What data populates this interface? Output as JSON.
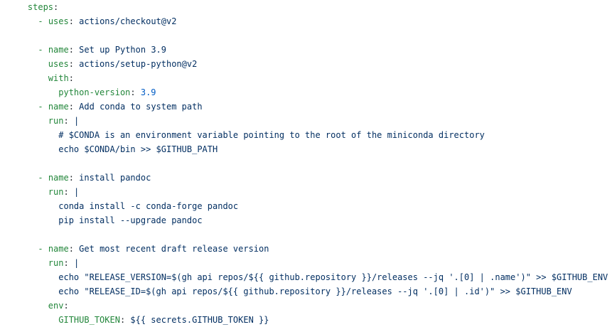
{
  "editor": {
    "lines": [
      {
        "indent": 4,
        "dash": false,
        "key": "steps",
        "sep": ":",
        "value": "",
        "kind": "val"
      },
      {
        "indent": 6,
        "dash": true,
        "key": "uses",
        "sep": ": ",
        "value": "actions/checkout@v2",
        "kind": "val"
      },
      {
        "indent": 0,
        "dash": false,
        "key": "",
        "sep": "",
        "value": "",
        "kind": "val"
      },
      {
        "indent": 6,
        "dash": true,
        "key": "name",
        "sep": ": ",
        "value": "Set up Python 3.9",
        "kind": "val"
      },
      {
        "indent": 8,
        "dash": false,
        "key": "uses",
        "sep": ": ",
        "value": "actions/setup-python@v2",
        "kind": "val"
      },
      {
        "indent": 8,
        "dash": false,
        "key": "with",
        "sep": ":",
        "value": "",
        "kind": "val"
      },
      {
        "indent": 10,
        "dash": false,
        "key": "python-version",
        "sep": ": ",
        "value": "3.9",
        "kind": "num"
      },
      {
        "indent": 6,
        "dash": true,
        "key": "name",
        "sep": ": ",
        "value": "Add conda to system path",
        "kind": "val"
      },
      {
        "indent": 8,
        "dash": false,
        "key": "run",
        "sep": ": ",
        "value": "|",
        "kind": "val"
      },
      {
        "indent": 10,
        "dash": false,
        "key": "",
        "sep": "",
        "value": "# $CONDA is an environment variable pointing to the root of the miniconda directory",
        "kind": "comment"
      },
      {
        "indent": 10,
        "dash": false,
        "key": "",
        "sep": "",
        "value": "echo $CONDA/bin >> $GITHUB_PATH",
        "kind": "val"
      },
      {
        "indent": 0,
        "dash": false,
        "key": "",
        "sep": "",
        "value": "",
        "kind": "val"
      },
      {
        "indent": 6,
        "dash": true,
        "key": "name",
        "sep": ": ",
        "value": "install pandoc",
        "kind": "val"
      },
      {
        "indent": 8,
        "dash": false,
        "key": "run",
        "sep": ": ",
        "value": "|",
        "kind": "val"
      },
      {
        "indent": 10,
        "dash": false,
        "key": "",
        "sep": "",
        "value": "conda install -c conda-forge pandoc",
        "kind": "val"
      },
      {
        "indent": 10,
        "dash": false,
        "key": "",
        "sep": "",
        "value": "pip install --upgrade pandoc",
        "kind": "val"
      },
      {
        "indent": 0,
        "dash": false,
        "key": "",
        "sep": "",
        "value": "",
        "kind": "val"
      },
      {
        "indent": 6,
        "dash": true,
        "key": "name",
        "sep": ": ",
        "value": "Get most recent draft release version",
        "kind": "val"
      },
      {
        "indent": 8,
        "dash": false,
        "key": "run",
        "sep": ": ",
        "value": "|",
        "kind": "val"
      },
      {
        "indent": 10,
        "dash": false,
        "key": "",
        "sep": "",
        "value": "echo \"RELEASE_VERSION=$(gh api repos/${{ github.repository }}/releases --jq '.[0] | .name')\" >> $GITHUB_ENV",
        "kind": "val"
      },
      {
        "indent": 10,
        "dash": false,
        "key": "",
        "sep": "",
        "value": "echo \"RELEASE_ID=$(gh api repos/${{ github.repository }}/releases --jq '.[0] | .id')\" >> $GITHUB_ENV",
        "kind": "val"
      },
      {
        "indent": 8,
        "dash": false,
        "key": "env",
        "sep": ":",
        "value": "",
        "kind": "val"
      },
      {
        "indent": 10,
        "dash": false,
        "key": "GITHUB_TOKEN",
        "sep": ": ",
        "value": "${{ secrets.GITHUB_TOKEN }}",
        "kind": "val"
      }
    ]
  }
}
